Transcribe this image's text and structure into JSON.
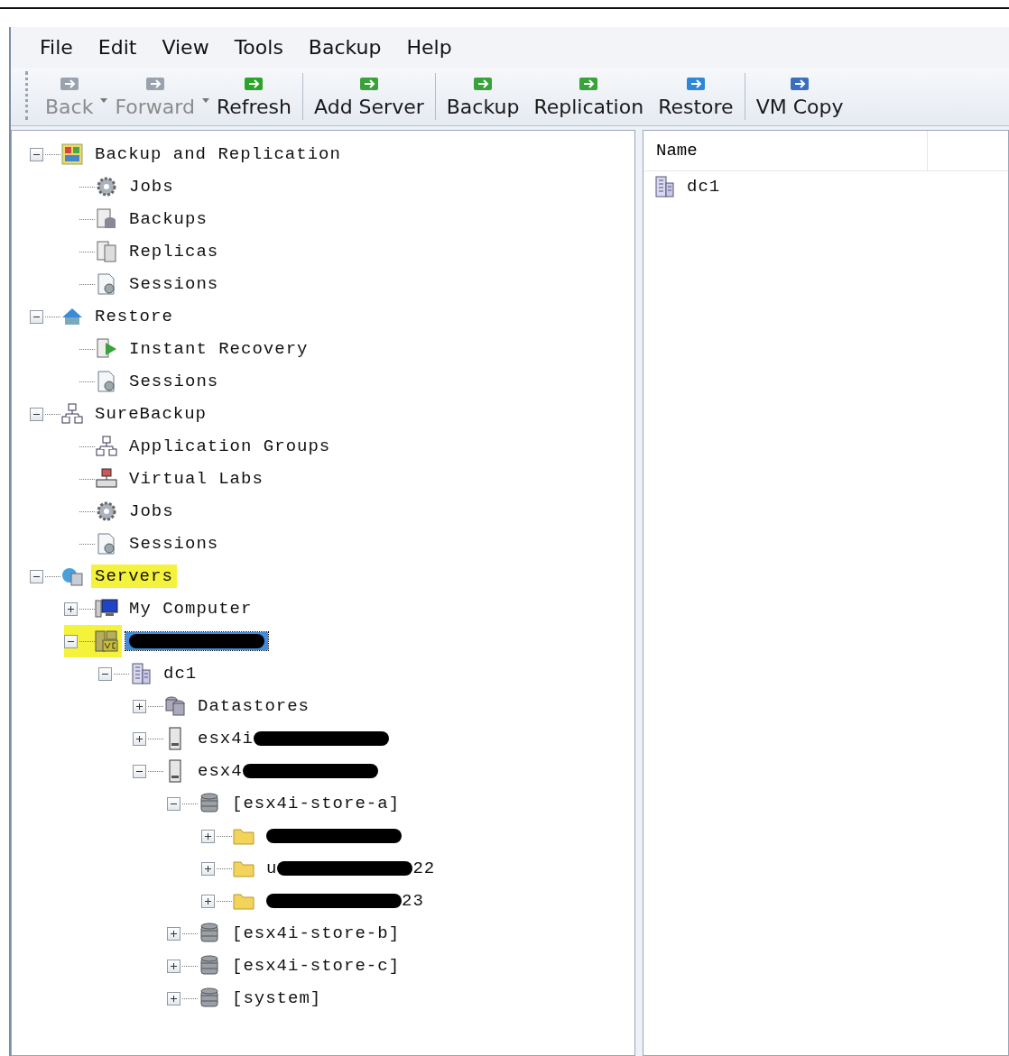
{
  "menu": [
    "File",
    "Edit",
    "View",
    "Tools",
    "Backup",
    "Help"
  ],
  "toolbar": [
    {
      "label": "Back",
      "kind": "back",
      "disabled": true,
      "has_menu": true,
      "separator_after": false
    },
    {
      "label": "Forward",
      "kind": "forward",
      "disabled": true,
      "has_menu": true,
      "separator_after": false
    },
    {
      "label": "Refresh",
      "kind": "refresh",
      "disabled": false,
      "has_menu": false,
      "separator_after": true
    },
    {
      "label": "Add Server",
      "kind": "add-server",
      "disabled": false,
      "has_menu": false,
      "separator_after": true
    },
    {
      "label": "Backup",
      "kind": "backup",
      "disabled": false,
      "has_menu": false,
      "separator_after": false
    },
    {
      "label": "Replication",
      "kind": "replication",
      "disabled": false,
      "has_menu": false,
      "separator_after": false
    },
    {
      "label": "Restore",
      "kind": "restore",
      "disabled": false,
      "has_menu": false,
      "separator_after": true
    },
    {
      "label": "VM Copy",
      "kind": "vm-copy",
      "disabled": false,
      "has_menu": false,
      "separator_after": false
    }
  ],
  "tree": [
    {
      "label": "Backup and Replication",
      "kind": "grid",
      "expanded": true,
      "selected": false,
      "children": [
        {
          "label": "Jobs",
          "kind": "gear",
          "selected": false
        },
        {
          "label": "Backups",
          "kind": "backups",
          "selected": false
        },
        {
          "label": "Replicas",
          "kind": "replicas",
          "selected": false
        },
        {
          "label": "Sessions",
          "kind": "sessions",
          "selected": false
        }
      ]
    },
    {
      "label": "Restore",
      "kind": "restore",
      "expanded": true,
      "selected": false,
      "children": [
        {
          "label": "Instant Recovery",
          "kind": "instant",
          "selected": false
        },
        {
          "label": "Sessions",
          "kind": "sessions",
          "selected": false
        }
      ]
    },
    {
      "label": "SureBackup",
      "kind": "network",
      "expanded": true,
      "selected": false,
      "children": [
        {
          "label": "Application Groups",
          "kind": "network",
          "selected": false
        },
        {
          "label": "Virtual Labs",
          "kind": "lab",
          "selected": false
        },
        {
          "label": "Jobs",
          "kind": "gear",
          "selected": false
        },
        {
          "label": "Sessions",
          "kind": "sessions",
          "selected": false
        }
      ]
    },
    {
      "label": "Servers",
      "kind": "servers",
      "expanded": true,
      "selected": false,
      "highlighted": true,
      "children": [
        {
          "label": "My Computer",
          "kind": "computer",
          "expanded": false,
          "selected": false
        },
        {
          "kind": "vcenter",
          "expanded": true,
          "selected": true,
          "redacted": true,
          "icon_highlighted": true,
          "children": [
            {
              "label": "dc1",
              "kind": "building",
              "expanded": true,
              "selected": false,
              "children": [
                {
                  "label": "Datastores",
                  "kind": "databases",
                  "expanded": false,
                  "selected": false
                },
                {
                  "label": "esx4i",
                  "kind": "host",
                  "expanded": false,
                  "selected": false,
                  "redacted": true
                },
                {
                  "label": "esx4",
                  "kind": "host",
                  "expanded": true,
                  "selected": false,
                  "redacted": true,
                  "children": [
                    {
                      "label": "[esx4i-store-a]",
                      "kind": "disk",
                      "expanded": true,
                      "selected": false,
                      "children": [
                        {
                          "kind": "folder",
                          "expanded": false,
                          "selected": false,
                          "redacted": true
                        },
                        {
                          "label": "u",
                          "label_end": "22",
                          "kind": "folder",
                          "expanded": false,
                          "selected": false,
                          "redacted": true
                        },
                        {
                          "label_end": "23",
                          "kind": "folder",
                          "expanded": false,
                          "selected": false,
                          "redacted": true
                        }
                      ]
                    },
                    {
                      "label": "[esx4i-store-b]",
                      "kind": "disk",
                      "expanded": false,
                      "selected": false
                    },
                    {
                      "label": "[esx4i-store-c]",
                      "kind": "disk",
                      "expanded": false,
                      "selected": false
                    },
                    {
                      "label": "[system]",
                      "kind": "disk",
                      "expanded": false,
                      "selected": false
                    }
                  ]
                }
              ]
            }
          ]
        }
      ]
    }
  ],
  "list": {
    "columns": [
      "Name"
    ],
    "rows": [
      {
        "name": "dc1",
        "kind": "building"
      }
    ]
  }
}
